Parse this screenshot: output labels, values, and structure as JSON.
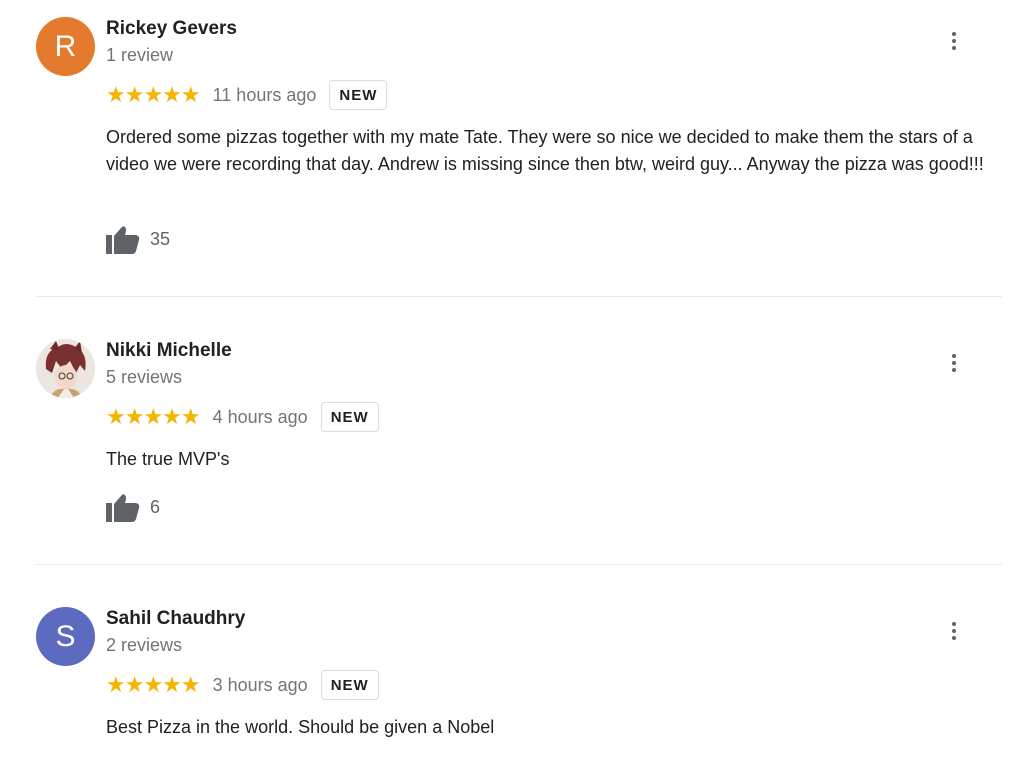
{
  "reviews": [
    {
      "avatar_letter": "R",
      "avatar_color": "#e37a2d",
      "name": "Rickey Gevers",
      "review_count": "1 review",
      "stars": "★★★★★",
      "time": "11 hours ago",
      "badge": "NEW",
      "text": "Ordered some pizzas together with my mate Tate. They were so nice we decided to make them the stars of a video we were recording that day. Andrew is missing since then btw, weird guy... Anyway the pizza was good!!!",
      "likes": "35"
    },
    {
      "avatar_letter": "",
      "avatar_color": "#e9e2dc",
      "name": "Nikki Michelle",
      "review_count": "5 reviews",
      "stars": "★★★★★",
      "time": "4 hours ago",
      "badge": "NEW",
      "text": "The true MVP's",
      "likes": "6"
    },
    {
      "avatar_letter": "S",
      "avatar_color": "#5c6bc0",
      "name": "Sahil Chaudhry",
      "review_count": "2 reviews",
      "stars": "★★★★★",
      "time": "3 hours ago",
      "badge": "NEW",
      "text": "Best Pizza in the world. Should be given a Nobel"
    }
  ],
  "icons": {
    "like": "thumb-up-icon",
    "more": "more-vert-icon",
    "star": "star-icon"
  }
}
